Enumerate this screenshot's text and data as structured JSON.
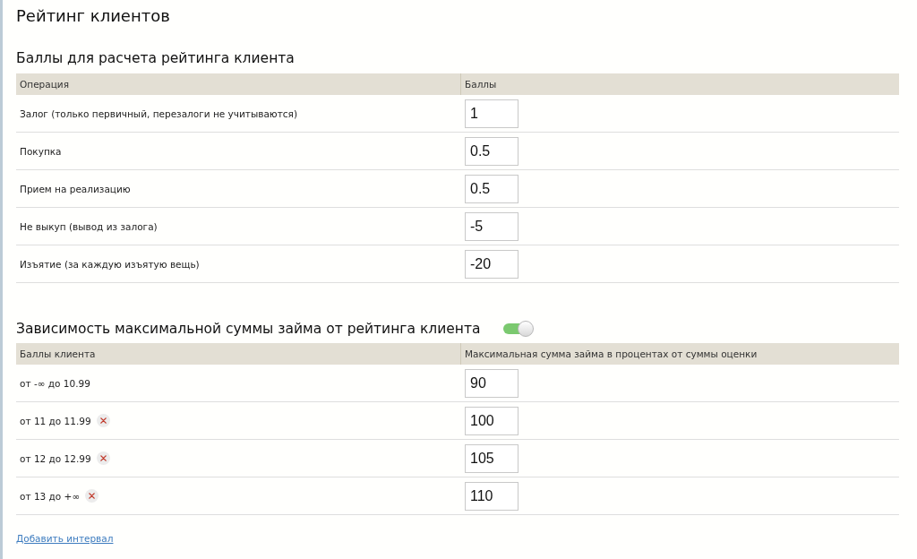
{
  "page": {
    "title": "Рейтинг клиентов"
  },
  "points_section": {
    "heading": "Баллы для расчета рейтинга клиента",
    "table": {
      "columns": [
        "Операция",
        "Баллы"
      ],
      "rows": [
        {
          "operation": "Залог (только первичный, перезалоги не учитываются)",
          "points": "1"
        },
        {
          "operation": "Покупка",
          "points": "0.5"
        },
        {
          "operation": "Прием на реализацию",
          "points": "0.5"
        },
        {
          "operation": "Не выкуп (вывод из залога)",
          "points": "-5"
        },
        {
          "operation": "Изъятие (за каждую изъятую вещь)",
          "points": "-20"
        }
      ]
    }
  },
  "loan_limit_section": {
    "heading": "Зависимость максимальной суммы займа от рейтинга клиента",
    "toggle": {
      "on": true
    },
    "table": {
      "columns": [
        "Баллы клиента",
        "Максимальная сумма займа в процентах от суммы оценки"
      ],
      "rows": [
        {
          "range": "от -∞ до 10.99",
          "percent": "90",
          "removable": false
        },
        {
          "range": "от 11 до 11.99",
          "percent": "100",
          "removable": true
        },
        {
          "range": "от 12 до 12.99",
          "percent": "105",
          "removable": true
        },
        {
          "range": "от 13 до +∞",
          "percent": "110",
          "removable": true
        }
      ]
    }
  },
  "add_interval_link": "Добавить интервал"
}
